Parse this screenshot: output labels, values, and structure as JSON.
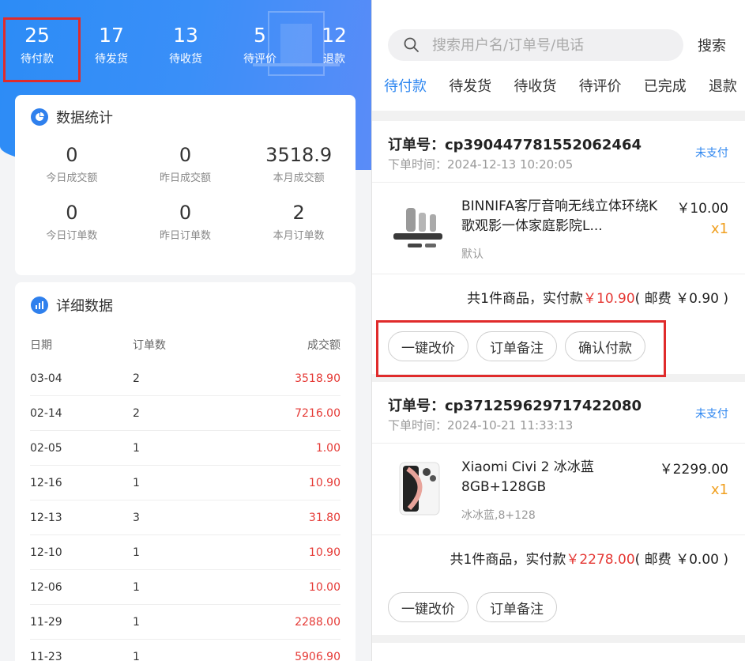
{
  "status_counts": [
    {
      "num": "25",
      "label": "待付款",
      "active": true
    },
    {
      "num": "17",
      "label": "待发货"
    },
    {
      "num": "13",
      "label": "待收货"
    },
    {
      "num": "5",
      "label": "待评价"
    },
    {
      "num": "12",
      "label": "退款"
    }
  ],
  "summary": {
    "title": "数据统计",
    "cells": [
      {
        "value": "0",
        "label": "今日成交额"
      },
      {
        "value": "0",
        "label": "昨日成交额"
      },
      {
        "value": "3518.9",
        "label": "本月成交额"
      },
      {
        "value": "0",
        "label": "今日订单数"
      },
      {
        "value": "0",
        "label": "昨日订单数"
      },
      {
        "value": "2",
        "label": "本月订单数"
      }
    ]
  },
  "detail": {
    "title": "详细数据",
    "headers": {
      "date": "日期",
      "orders": "订单数",
      "amount": "成交额"
    },
    "rows": [
      {
        "date": "03-04",
        "orders": "2",
        "amount": "3518.90"
      },
      {
        "date": "02-14",
        "orders": "2",
        "amount": "7216.00"
      },
      {
        "date": "02-05",
        "orders": "1",
        "amount": "1.00"
      },
      {
        "date": "12-16",
        "orders": "1",
        "amount": "10.90"
      },
      {
        "date": "12-13",
        "orders": "3",
        "amount": "31.80"
      },
      {
        "date": "12-10",
        "orders": "1",
        "amount": "10.90"
      },
      {
        "date": "12-06",
        "orders": "1",
        "amount": "10.00"
      },
      {
        "date": "11-29",
        "orders": "1",
        "amount": "2288.00"
      },
      {
        "date": "11-23",
        "orders": "1",
        "amount": "5906.90"
      }
    ]
  },
  "search": {
    "placeholder": "搜索用户名/订单号/电话",
    "button": "搜索"
  },
  "tabs": [
    "待付款",
    "待发货",
    "待收货",
    "待评价",
    "已完成",
    "退款"
  ],
  "orders": [
    {
      "no": "订单号：cp390447781552062464",
      "time": "下单时间：2024-12-13 10:20:05",
      "status": "未支付",
      "product_name": "BINNIFA客厅音响无线立体环绕K歌观影一体家庭影院L...",
      "spec": "默认",
      "price": "￥10.00",
      "qty": "x1",
      "total_prefix": "共1件商品，实付款",
      "total_pay": "￥10.90",
      "total_suffix": "( 邮费 ￥0.90 )",
      "actions": [
        "一键改价",
        "订单备注",
        "确认付款"
      ]
    },
    {
      "no": "订单号：cp371259629717422080",
      "time": "下单时间：2024-10-21 11:33:13",
      "status": "未支付",
      "product_name": "Xiaomi Civi 2 冰冰蓝 8GB+128GB",
      "spec": "冰冰蓝,8+128",
      "price": "￥2299.00",
      "qty": "x1",
      "total_prefix": "共1件商品，实付款",
      "total_pay": "￥2278.00",
      "total_suffix": "( 邮费 ￥0.00 )",
      "actions": [
        "一键改价",
        "订单备注"
      ]
    }
  ],
  "colors": {
    "accent": "#2d86f0",
    "price_red": "#e53935",
    "qty_orange": "#f0a020",
    "highlight": "#e02b2b"
  }
}
